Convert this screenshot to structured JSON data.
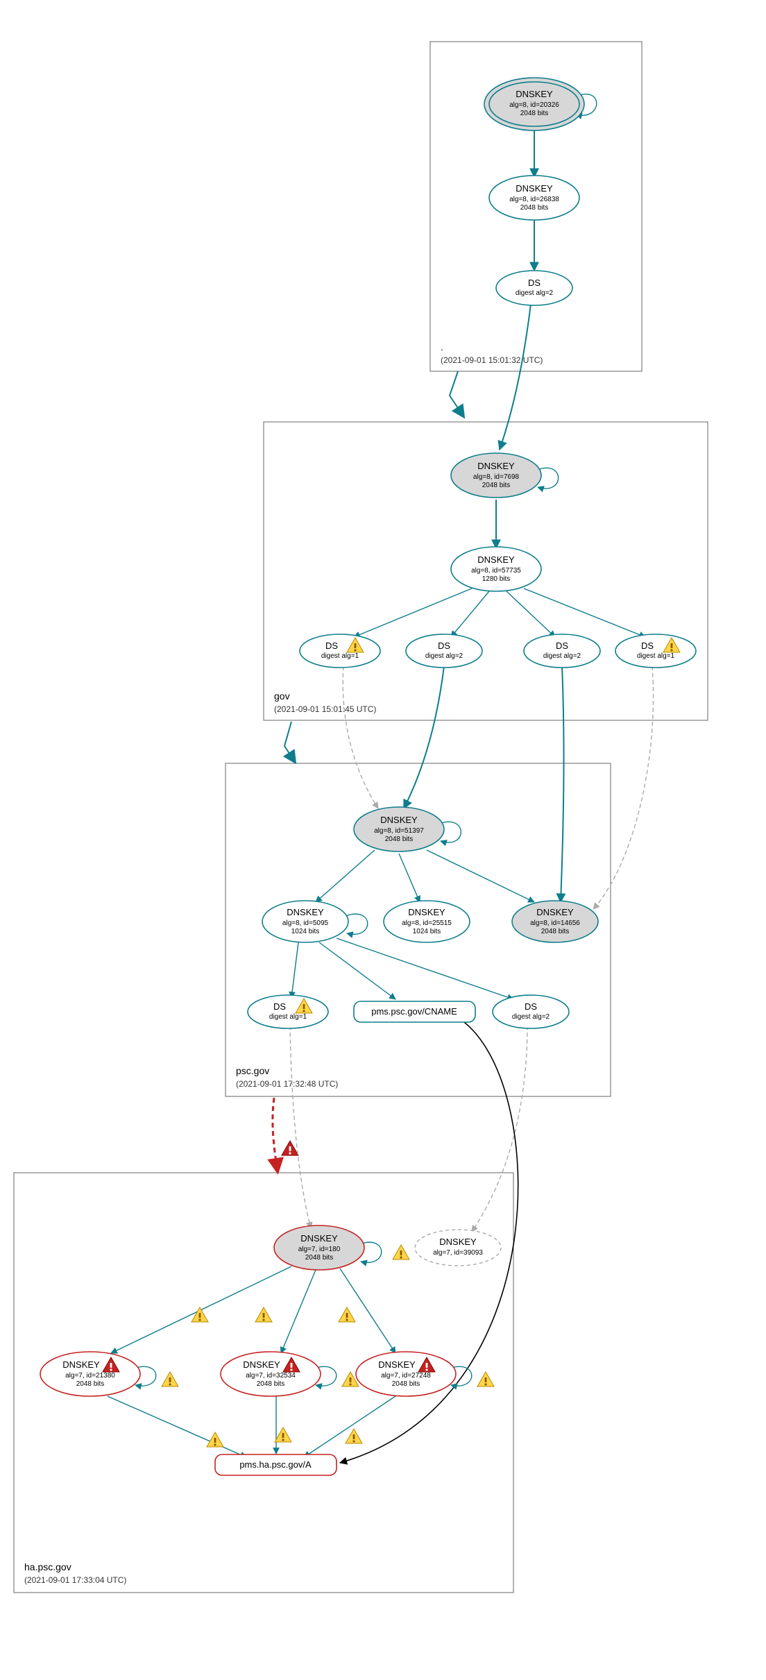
{
  "zones": {
    "root": {
      "label": ".",
      "ts": "(2021-09-01 15:01:32 UTC)"
    },
    "gov": {
      "label": "gov",
      "ts": "(2021-09-01 15:01:45 UTC)"
    },
    "psc": {
      "label": "psc.gov",
      "ts": "(2021-09-01 17:32:48 UTC)"
    },
    "ha": {
      "label": "ha.psc.gov",
      "ts": "(2021-09-01 17:33:04 UTC)"
    }
  },
  "nodes": {
    "root_ksk": {
      "l1": "DNSKEY",
      "l2": "alg=8, id=20326",
      "l3": "2048 bits"
    },
    "root_zsk": {
      "l1": "DNSKEY",
      "l2": "alg=8, id=26838",
      "l3": "2048 bits"
    },
    "root_ds": {
      "l1": "DS",
      "l2": "digest alg=2"
    },
    "gov_ksk": {
      "l1": "DNSKEY",
      "l2": "alg=8, id=7698",
      "l3": "2048 bits"
    },
    "gov_zsk": {
      "l1": "DNSKEY",
      "l2": "alg=8, id=57735",
      "l3": "1280 bits"
    },
    "gov_ds1": {
      "l1": "DS",
      "l2": "digest alg=1"
    },
    "gov_ds2": {
      "l1": "DS",
      "l2": "digest alg=2"
    },
    "gov_ds3": {
      "l1": "DS",
      "l2": "digest alg=2"
    },
    "gov_ds4": {
      "l1": "DS",
      "l2": "digest alg=1"
    },
    "psc_ksk": {
      "l1": "DNSKEY",
      "l2": "alg=8, id=51397",
      "l3": "2048 bits"
    },
    "psc_zsk1": {
      "l1": "DNSKEY",
      "l2": "alg=8, id=5095",
      "l3": "1024 bits"
    },
    "psc_zsk2": {
      "l1": "DNSKEY",
      "l2": "alg=8, id=25515",
      "l3": "1024 bits"
    },
    "psc_zsk3": {
      "l1": "DNSKEY",
      "l2": "alg=8, id=14656",
      "l3": "2048 bits"
    },
    "psc_ds1": {
      "l1": "DS",
      "l2": "digest alg=1"
    },
    "psc_cname": {
      "l1": "pms.psc.gov/CNAME"
    },
    "psc_ds2": {
      "l1": "DS",
      "l2": "digest alg=2"
    },
    "ha_ksk": {
      "l1": "DNSKEY",
      "l2": "alg=7, id=180",
      "l3": "2048 bits"
    },
    "ha_zskX": {
      "l1": "DNSKEY",
      "l2": "alg=7, id=39093"
    },
    "ha_zsk1": {
      "l1": "DNSKEY",
      "l2": "alg=7, id=21380",
      "l3": "2048 bits"
    },
    "ha_zsk2": {
      "l1": "DNSKEY",
      "l2": "alg=7, id=32534",
      "l3": "2048 bits"
    },
    "ha_zsk3": {
      "l1": "DNSKEY",
      "l2": "alg=7, id=27248",
      "l3": "2048 bits"
    },
    "ha_a": {
      "l1": "pms.ha.psc.gov/A"
    }
  }
}
